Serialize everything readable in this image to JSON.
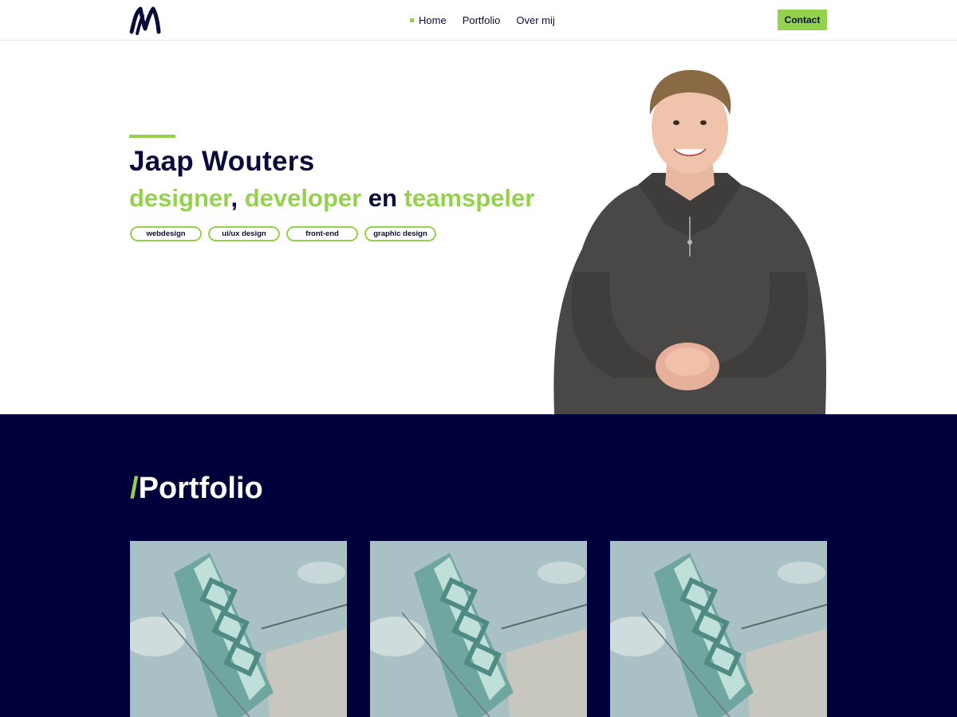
{
  "header": {
    "logo_icon": "jw-monogram-logo",
    "nav": [
      {
        "label": "Home",
        "active": true
      },
      {
        "label": "Portfolio",
        "active": false
      },
      {
        "label": "Over mij",
        "active": false
      }
    ],
    "contact_label": "Contact"
  },
  "hero": {
    "name": "Jaap Wouters",
    "role": {
      "part1": "designer",
      "sep1": ", ",
      "part2": "developer",
      "sep2": " en ",
      "part3": "teamspeler"
    },
    "tags": [
      "webdesign",
      "ui/ux design",
      "front-end",
      "graphic design"
    ],
    "portrait": "portrait-photo"
  },
  "portfolio": {
    "slash": "/",
    "title": "Portfolio",
    "items": [
      {
        "image": "hotel-sign-photo"
      },
      {
        "image": "hotel-sign-photo"
      },
      {
        "image": "hotel-sign-photo"
      }
    ]
  },
  "colors": {
    "accent": "#95d24b",
    "navy": "#00003a",
    "text": "#0a0b3a"
  }
}
